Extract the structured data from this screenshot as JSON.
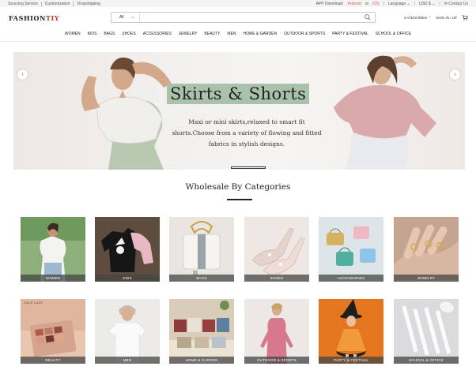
{
  "topbar": {
    "links": [
      "Sourcing Service",
      "Customization",
      "Dropshipping"
    ],
    "app_download": "APP Download:",
    "android": "Android",
    "or": "or",
    "ios": "iOS",
    "language": "Language",
    "currency": "USD $",
    "contact": "Contact Us"
  },
  "header": {
    "logo_main": "FASHION",
    "logo_accent": "TIY",
    "search_category": "All",
    "search_placeholder": "",
    "categories": "CATEGORIES",
    "sign_in": "SIGN IN / UP"
  },
  "nav": [
    "WOMEN",
    "KIDS",
    "BAGS",
    "SHOES",
    "ACCESSORIES",
    "JEWELRY",
    "BEAUTY",
    "MEN",
    "HOME & GARDEN",
    "OUTDOOR & SPORTS",
    "PARTY & FESTIVAL",
    "SCHOOL & OFFICE"
  ],
  "banner": {
    "title": "Skirts & Shorts",
    "description": "Maxi or mini skirts,relaxed to smart fit shorts.Choose from a variety of flowing and fitted fabrics in stylish designs."
  },
  "section": {
    "title": "Wholesale By Categories"
  },
  "categories": [
    {
      "label": "WOMEN",
      "bg": "#7fa56a"
    },
    {
      "label": "KIDS",
      "bg": "#5a4a3c"
    },
    {
      "label": "BAGS",
      "bg": "#e8e4df"
    },
    {
      "label": "SHOES",
      "bg": "#ebe5e2"
    },
    {
      "label": "ACCESSORIES",
      "bg": "#d9e2e6"
    },
    {
      "label": "JEWELRY",
      "bg": "#b89a86"
    },
    {
      "label": "BEAUTY",
      "bg": "#e6c3ad",
      "brand": "SACE LADY"
    },
    {
      "label": "MEN",
      "bg": "#e9e7e3"
    },
    {
      "label": "HOME & GARDEN",
      "bg": "#d6c8b4"
    },
    {
      "label": "OUTDOOR & SPORTS",
      "bg": "#e7e4e2"
    },
    {
      "label": "PARTY & FESTIVAL",
      "bg": "#e2701e"
    },
    {
      "label": "SCHOOL & OFFICE",
      "bg": "#d9d9dc"
    }
  ]
}
